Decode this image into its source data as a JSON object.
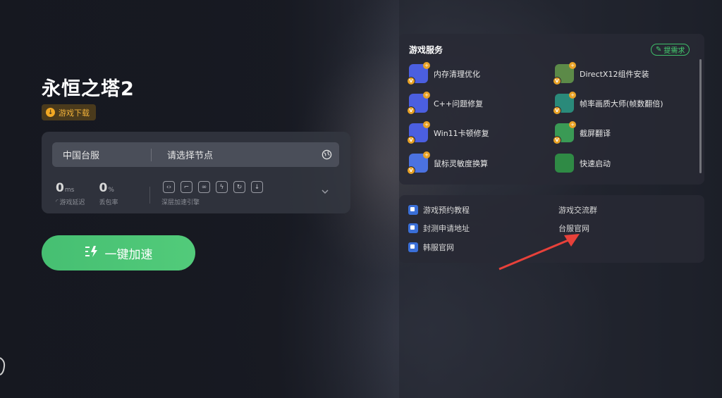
{
  "game": {
    "title": "永恒之塔2",
    "download_label": "游戏下载"
  },
  "server": {
    "region": "中国台服",
    "node_placeholder": "请选择节点"
  },
  "stats": {
    "latency_value": "0",
    "latency_unit": "ms",
    "latency_label": "游戏延迟",
    "loss_value": "0",
    "loss_unit": "%",
    "loss_label": "丢包率",
    "accel_label": "深层加速引擎"
  },
  "boost": {
    "label": "一键加速"
  },
  "services": {
    "title": "游戏服务",
    "request_label": "提需求",
    "items": [
      {
        "label": "内存清理优化",
        "icon": "memory-clean-icon",
        "color": "#4b5fe0"
      },
      {
        "label": "DirectX12组件安装",
        "icon": "directx-icon",
        "color": "#5c8a48"
      },
      {
        "label": "C++问题修复",
        "icon": "cpp-fix-icon",
        "color": "#4b5fe0"
      },
      {
        "label": "帧率画质大师(帧数翻倍)",
        "icon": "framerate-icon",
        "color": "#2a8a7a"
      },
      {
        "label": "Win11卡顿修复",
        "icon": "win11-fix-icon",
        "color": "#4b5fe0"
      },
      {
        "label": "截屏翻译",
        "icon": "screenshot-translate-icon",
        "color": "#3a9a55"
      },
      {
        "label": "鼠标灵敏度换算",
        "icon": "mouse-sensitivity-icon",
        "color": "#4b72e0"
      },
      {
        "label": "快速启动",
        "icon": "quick-launch-icon",
        "color": "#2f8a45"
      }
    ]
  },
  "links": {
    "items": [
      {
        "label": "游戏预约教程"
      },
      {
        "label": "游戏交流群"
      },
      {
        "label": "封测申请地址"
      },
      {
        "label": "台服官网"
      },
      {
        "label": "韩服官网"
      }
    ]
  }
}
